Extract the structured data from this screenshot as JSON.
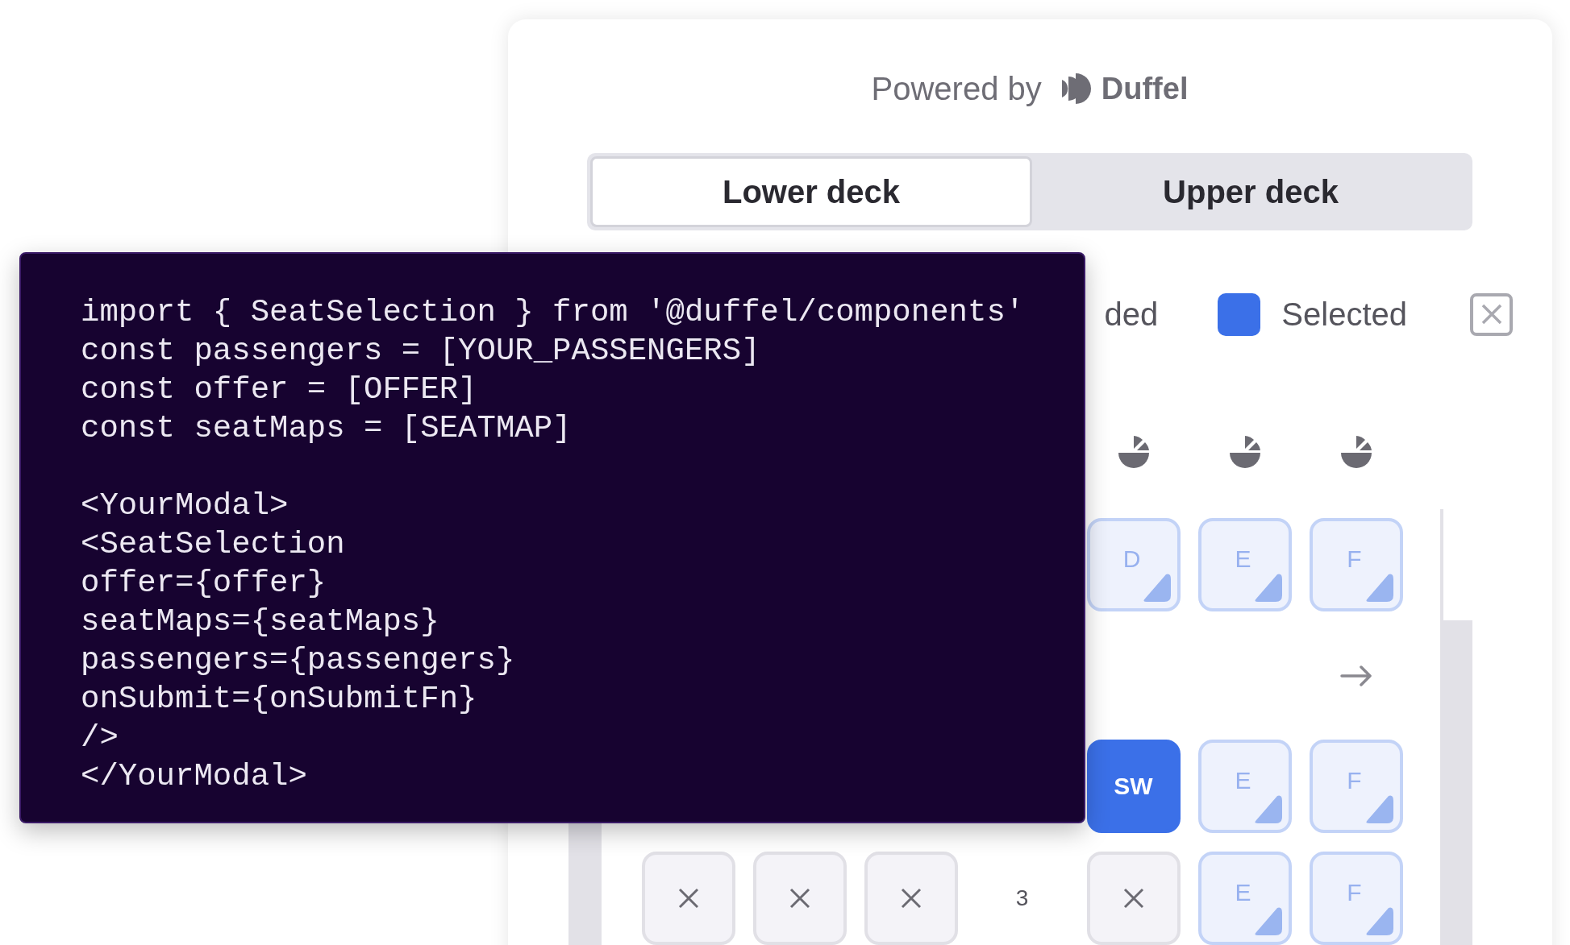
{
  "header": {
    "powered_by": "Powered by",
    "brand": "Duffel"
  },
  "tabs": [
    {
      "label": "Lower deck",
      "selected": true
    },
    {
      "label": "Upper deck",
      "selected": false
    }
  ],
  "legend": [
    {
      "label": "ded"
    },
    {
      "label": "Selected",
      "color": "#3b70e8"
    }
  ],
  "seat_rows": [
    {
      "cells": [
        {
          "kind": "gap"
        },
        {
          "kind": "gap"
        },
        {
          "kind": "gap"
        },
        {
          "kind": "gap"
        },
        {
          "kind": "bassinet"
        },
        {
          "kind": "bassinet"
        },
        {
          "kind": "bassinet"
        }
      ]
    },
    {
      "cells": [
        {
          "kind": "gap"
        },
        {
          "kind": "gap"
        },
        {
          "kind": "gap"
        },
        {
          "kind": "gap"
        },
        {
          "kind": "available",
          "label": "D"
        },
        {
          "kind": "available",
          "label": "E"
        },
        {
          "kind": "available",
          "label": "F"
        }
      ]
    },
    {
      "cells": [
        {
          "kind": "gap"
        },
        {
          "kind": "gap"
        },
        {
          "kind": "gap"
        },
        {
          "kind": "gap"
        },
        {
          "kind": "gap"
        },
        {
          "kind": "gap"
        },
        {
          "kind": "exit"
        }
      ]
    },
    {
      "cells": [
        {
          "kind": "gap"
        },
        {
          "kind": "gap"
        },
        {
          "kind": "gap"
        },
        {
          "kind": "gap"
        },
        {
          "kind": "selected",
          "label": "SW"
        },
        {
          "kind": "available",
          "label": "E"
        },
        {
          "kind": "available",
          "label": "F"
        }
      ]
    },
    {
      "cells": [
        {
          "kind": "unavailable"
        },
        {
          "kind": "unavailable"
        },
        {
          "kind": "unavailable"
        },
        {
          "kind": "row_number",
          "label": "3"
        },
        {
          "kind": "unavailable"
        },
        {
          "kind": "available",
          "label": "E"
        },
        {
          "kind": "available",
          "label": "F"
        }
      ]
    }
  ],
  "code": {
    "blocks": [
      [
        "import { SeatSelection } from '@duffel/components'",
        "const passengers = [YOUR_PASSENGERS]",
        "const offer = [OFFER]",
        "const seatMaps = [SEATMAP]"
      ],
      [
        "<YourModal>",
        "<SeatSelection",
        "offer={offer}",
        "seatMaps={seatMaps}",
        "passengers={passengers}",
        "onSubmit={onSubmitFn}",
        "/>",
        "</YourModal>"
      ]
    ]
  }
}
